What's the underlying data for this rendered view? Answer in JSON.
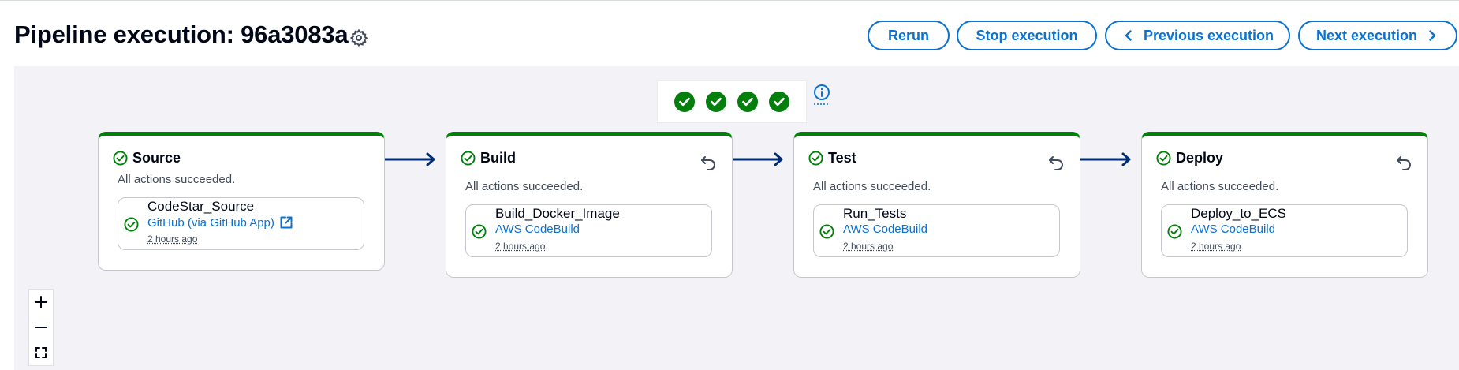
{
  "header": {
    "title": "Pipeline execution: 96a3083a",
    "buttons": {
      "rerun": "Rerun",
      "stop": "Stop execution",
      "previous": "Previous execution",
      "next": "Next execution"
    }
  },
  "colors": {
    "accent": "#0972d3",
    "success": "#037f0c",
    "connector": "#002d72",
    "canvas": "#f3f3f7"
  },
  "summary": {
    "succeeded_stage_count": 4
  },
  "stages": [
    {
      "name": "Source",
      "status": "All actions succeeded.",
      "action": {
        "name": "CodeStar_Source",
        "provider": "GitHub (via GitHub App)",
        "time": "2 hours ago"
      }
    },
    {
      "name": "Build",
      "status": "All actions succeeded.",
      "action": {
        "name": "Build_Docker_Image",
        "provider": "AWS CodeBuild",
        "time": "2 hours ago"
      }
    },
    {
      "name": "Test",
      "status": "All actions succeeded.",
      "action": {
        "name": "Run_Tests",
        "provider": "AWS CodeBuild",
        "time": "2 hours ago"
      }
    },
    {
      "name": "Deploy",
      "status": "All actions succeeded.",
      "action": {
        "name": "Deploy_to_ECS",
        "provider": "AWS CodeBuild",
        "time": "2 hours ago"
      }
    }
  ],
  "icons": {
    "settings": "gear-icon",
    "info": "info-icon",
    "success": "check-circle-icon",
    "retry": "undo-arrow-icon",
    "external": "external-link-icon",
    "zoom_in": "plus-icon",
    "zoom_out": "minus-icon",
    "fit": "fit-view-icon"
  }
}
